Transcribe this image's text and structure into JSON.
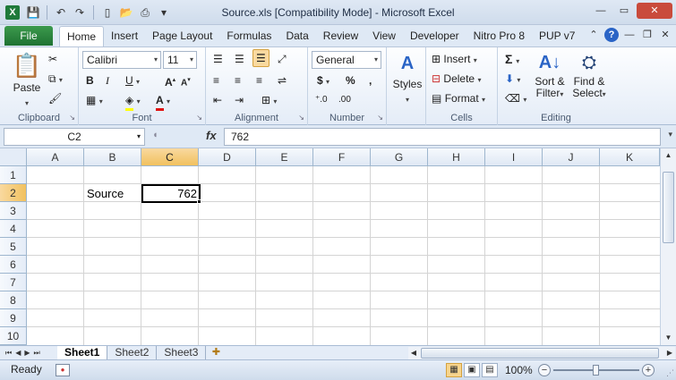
{
  "window": {
    "title": "Source.xls  [Compatibility Mode]  -  Microsoft Excel",
    "app_icon": "X",
    "qat_icons": [
      "save-icon",
      "undo-icon",
      "redo-icon",
      "new-icon",
      "open-icon",
      "print-preview-icon",
      "customize-icon"
    ]
  },
  "tabs": {
    "file": "File",
    "items": [
      "Home",
      "Insert",
      "Page Layout",
      "Formulas",
      "Data",
      "Review",
      "View",
      "Developer",
      "Nitro Pro 8",
      "PUP v7"
    ],
    "active": "Home"
  },
  "ribbon": {
    "clipboard": {
      "label": "Clipboard",
      "paste": "Paste"
    },
    "font": {
      "label": "Font",
      "name": "Calibri",
      "size": "11",
      "bold": "B",
      "italic": "I",
      "underline": "U"
    },
    "alignment": {
      "label": "Alignment"
    },
    "number": {
      "label": "Number",
      "format": "General",
      "currency": "$",
      "percent": "%",
      "comma": ","
    },
    "styles": {
      "label": "Styles"
    },
    "cells": {
      "label": "Cells",
      "insert": "Insert",
      "delete": "Delete",
      "format": "Format"
    },
    "editing": {
      "label": "Editing",
      "sort": "Sort &",
      "filter": "Filter",
      "find": "Find &",
      "select": "Select",
      "sigma": "Σ"
    }
  },
  "formula_bar": {
    "name_box": "C2",
    "fx": "fx",
    "value": "762"
  },
  "grid": {
    "columns": [
      "A",
      "B",
      "C",
      "D",
      "E",
      "F",
      "G",
      "H",
      "I",
      "J",
      "K"
    ],
    "rows": [
      "1",
      "2",
      "3",
      "4",
      "5",
      "6",
      "7",
      "8",
      "9",
      "10"
    ],
    "selected_col": "C",
    "selected_row": "2",
    "cells": {
      "B2": "Source",
      "C2": "762"
    }
  },
  "sheets": {
    "items": [
      "Sheet1",
      "Sheet2",
      "Sheet3"
    ],
    "active": "Sheet1"
  },
  "status": {
    "text": "Ready",
    "zoom": "100%"
  },
  "colors": {
    "accent": "#1e7232",
    "selection": "#f1c15f",
    "close": "#c94b3c"
  }
}
